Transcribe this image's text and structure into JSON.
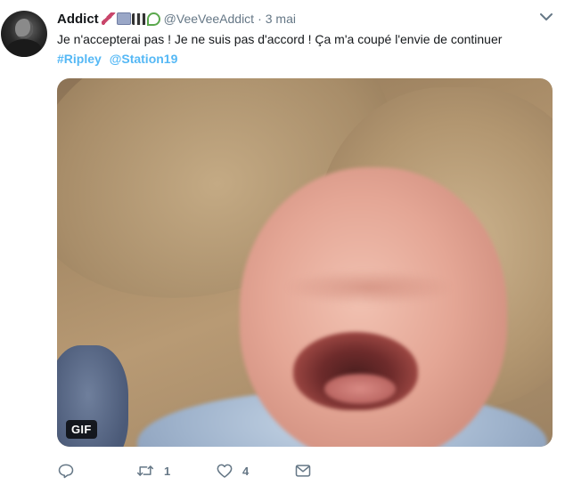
{
  "user": {
    "display_name": "Addict",
    "emoji_badges": [
      "syringe-emoji",
      "tv-emoji",
      "clapperboard-emoji",
      "plant-emoji"
    ],
    "handle": "@VeeVeeAddict",
    "separator": "·",
    "timestamp": "3 mai"
  },
  "tweet": {
    "text": "Je n'accepterai pas ! Je ne suis pas d'accord ! Ça m'a coupé l'envie de continuer",
    "hashtag": "#Ripley",
    "mention": "@Station19"
  },
  "media": {
    "type": "gif",
    "badge": "GIF",
    "subject": "crying-baby"
  },
  "actions": {
    "reply_count": "",
    "retweet_count": "1",
    "like_count": "4"
  },
  "icons": {
    "more": "chevron-down-icon",
    "reply": "reply-icon",
    "retweet": "retweet-icon",
    "like": "heart-icon",
    "dm": "envelope-icon"
  },
  "colors": {
    "link": "#1da1f2",
    "text": "#14171a",
    "muted": "#657786"
  }
}
